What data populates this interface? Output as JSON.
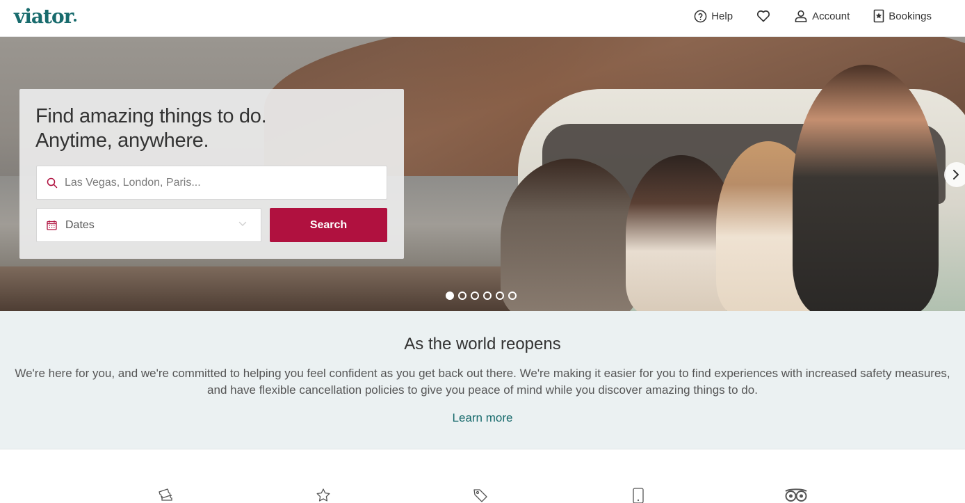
{
  "header": {
    "logo": "viator",
    "nav": {
      "help": "Help",
      "account": "Account",
      "bookings": "Bookings"
    }
  },
  "hero": {
    "headline_line1": "Find amazing things to do.",
    "headline_line2": "Anytime, anywhere.",
    "search_placeholder": "Las Vegas, London, Paris...",
    "dates_label": "Dates",
    "search_button": "Search",
    "carousel_slides": 6,
    "carousel_active": 1
  },
  "reopen": {
    "title": "As the world reopens",
    "body": "We're here for you, and we're committed to helping you feel confident as you get back out there. We're making it easier for you to find experiences with increased safety measures, and have flexible cancellation policies to give you peace of mind while you discover amazing things to do.",
    "learn_more": "Learn more"
  },
  "features": {
    "icons": [
      "ticket-icon",
      "star-icon",
      "tag-icon",
      "phone-icon",
      "tripadvisor-icon"
    ]
  },
  "colors": {
    "brand": "#186b6d",
    "accent": "#b0113f",
    "section_bg": "#ebf1f2"
  }
}
